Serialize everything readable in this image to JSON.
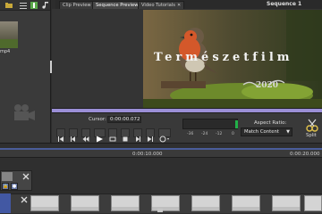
{
  "bin": {
    "item_label": "mp4"
  },
  "tabs": [
    {
      "label": "Clip Preview"
    },
    {
      "label": "Sequence Preview"
    },
    {
      "label": "Video Tutorials"
    }
  ],
  "sequence_title": "Sequence 1",
  "video": {
    "title_overlay": "Természetfilm",
    "year_overlay": "2020"
  },
  "transport": {
    "cursor_label": "Cursor:",
    "cursor_value": "0:00:00.072",
    "meter_labels": [
      "-36",
      "-24",
      "-12",
      "0"
    ],
    "aspect_label": "Aspect Ratio:",
    "aspect_value": "Match Content",
    "split_label": "Split"
  },
  "timeline": {
    "ticks": [
      "0:00:10.000",
      "0:00:20.000"
    ]
  },
  "colors": {
    "progress": "#9b8fd6",
    "meter_level": "#21b048",
    "timeline_accent": "#4258a3"
  }
}
